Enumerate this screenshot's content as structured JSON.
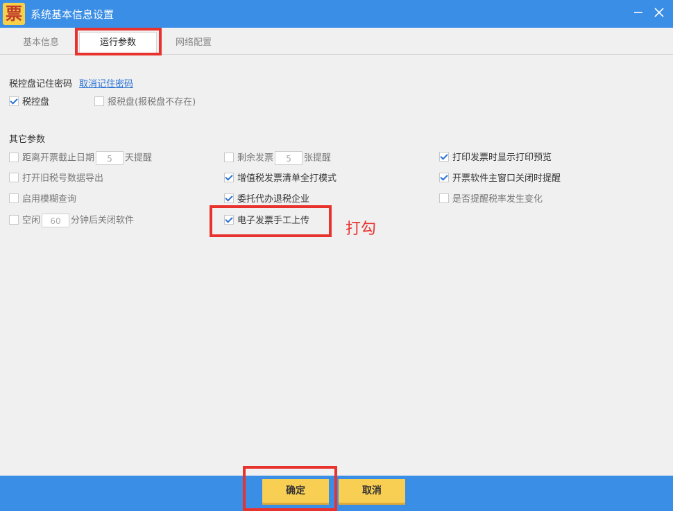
{
  "window": {
    "icon_glyph": "票",
    "title": "系统基本信息设置",
    "minimize_icon": "minimize-icon",
    "close_icon": "close-icon"
  },
  "tabs": [
    {
      "label": "基本信息",
      "active": false
    },
    {
      "label": "运行参数",
      "active": true
    },
    {
      "label": "网络配置",
      "active": false
    }
  ],
  "password_section": {
    "title": "税控盘记住密码",
    "cancel_link": "取消记住密码",
    "options": [
      {
        "label": "税控盘",
        "checked": true,
        "enabled": true
      },
      {
        "label": "报税盘(报税盘不存在)",
        "checked": false,
        "enabled": false
      }
    ]
  },
  "other_section": {
    "title": "其它参数",
    "col1": [
      {
        "label_before": "距离开票截止日期",
        "value": "5",
        "label_after": "天提醒",
        "checked": false
      },
      {
        "label": "打开旧税号数据导出",
        "checked": false
      },
      {
        "label": "启用模糊查询",
        "checked": false
      },
      {
        "label_before": "空闲",
        "value": "60",
        "label_after": "分钟后关闭软件",
        "checked": false
      }
    ],
    "col2": [
      {
        "label_before": "剩余发票",
        "value": "5",
        "label_after": "张提醒",
        "checked": false
      },
      {
        "label": "增值税发票清单全打模式",
        "checked": true
      },
      {
        "label": "委托代办退税企业",
        "checked": true
      },
      {
        "label": "电子发票手工上传",
        "checked": true
      }
    ],
    "col3": [
      {
        "label": "打印发票时显示打印预览",
        "checked": true
      },
      {
        "label": "开票软件主窗口关闭时提醒",
        "checked": true
      },
      {
        "label": "是否提醒税率发生变化",
        "checked": false
      }
    ]
  },
  "annotation": {
    "text": "打勾",
    "color": "#e8322d"
  },
  "footer": {
    "ok_label": "确定",
    "cancel_label": "取消"
  },
  "colors": {
    "titlebar": "#3a8ee6",
    "button": "#f9cf53",
    "link": "#2a72d4",
    "highlight": "#e8322d"
  }
}
